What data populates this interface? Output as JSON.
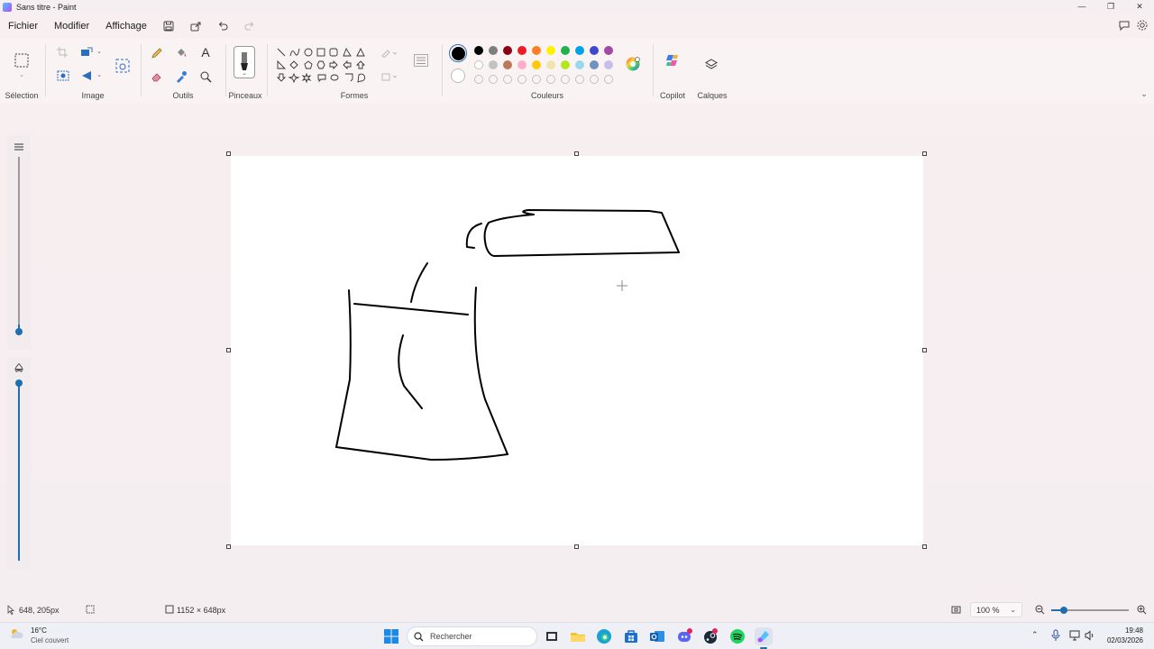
{
  "window": {
    "title": "Sans titre - Paint",
    "controls": [
      "minimize-icon",
      "restore-icon",
      "close-icon"
    ]
  },
  "menubar": {
    "items": [
      "Fichier",
      "Modifier",
      "Affichage"
    ]
  },
  "ribbon": {
    "groups": {
      "selection": "Sélection",
      "image": "Image",
      "tools": "Outils",
      "brushes": "Pinceaux",
      "shapes": "Formes",
      "colors": "Couleurs",
      "copilot": "Copilot",
      "layers": "Calques"
    },
    "text_tool": "A",
    "colors": {
      "primary": "#000000",
      "secondary": "#ffffff",
      "palette_row1": [
        "#000000",
        "#7f7f7f",
        "#880015",
        "#ed1c24",
        "#ff7f27",
        "#fff200",
        "#22b14c",
        "#00a2e8",
        "#3f48cc",
        "#a349a4"
      ],
      "palette_row2": [
        "#ffffff",
        "#c3c3c3",
        "#b97a57",
        "#ffaec9",
        "#ffc90e",
        "#efe4b0",
        "#b5e61d",
        "#99d9ea",
        "#7092be",
        "#c8bfe7"
      ]
    }
  },
  "canvas": {
    "background": "#ffffff"
  },
  "statusbar": {
    "cursor_position": "648, 205px",
    "canvas_size": "1152 × 648px",
    "zoom": "100 %"
  },
  "taskbar": {
    "weather_temp": "16°C",
    "weather_desc": "Ciel couvert",
    "search_placeholder": "Rechercher",
    "time": "19:48",
    "date": "02/03/2026"
  }
}
